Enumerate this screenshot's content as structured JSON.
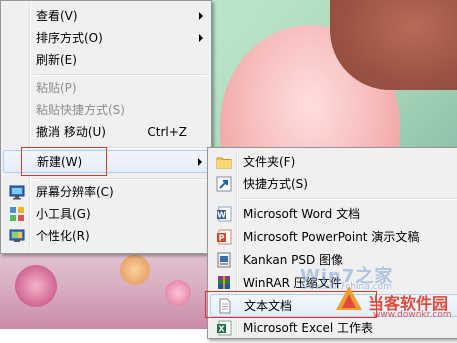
{
  "context_menu": {
    "items": [
      {
        "label": "查看(V)",
        "submenu": true
      },
      {
        "label": "排序方式(O)",
        "submenu": true
      },
      {
        "label": "刷新(E)"
      },
      {
        "label": "粘贴(P)",
        "disabled": true
      },
      {
        "label": "粘贴快捷方式(S)",
        "disabled": true
      },
      {
        "label": "撤消 移动(U)",
        "shortcut": "Ctrl+Z"
      },
      {
        "label": "新建(W)",
        "submenu": true,
        "highlighted": true
      },
      {
        "label": "屏幕分辨率(C)"
      },
      {
        "label": "小工具(G)"
      },
      {
        "label": "个性化(R)"
      }
    ]
  },
  "new_submenu": {
    "items": [
      {
        "label": "文件夹(F)",
        "icon": "folder-icon"
      },
      {
        "label": "快捷方式(S)",
        "icon": "shortcut-icon"
      },
      {
        "label": "Microsoft Word 文档",
        "icon": "word-icon"
      },
      {
        "label": "Microsoft PowerPoint 演示文稿",
        "icon": "powerpoint-icon"
      },
      {
        "label": "Kankan PSD 图像",
        "icon": "psd-icon"
      },
      {
        "label": "WinRAR 压缩文件",
        "icon": "winrar-icon"
      },
      {
        "label": "文本文档",
        "icon": "text-document-icon",
        "highlighted": true
      },
      {
        "label": "Microsoft Excel 工作表",
        "icon": "excel-icon"
      }
    ]
  },
  "watermark": {
    "brand": "Win7之家",
    "brand_url": "www.win7china.com",
    "site": "当客软件园",
    "site_url": "www.downkr.com"
  },
  "colors": {
    "highlight_box": "#e0342a",
    "menu_bg": "#f0f0f0"
  }
}
